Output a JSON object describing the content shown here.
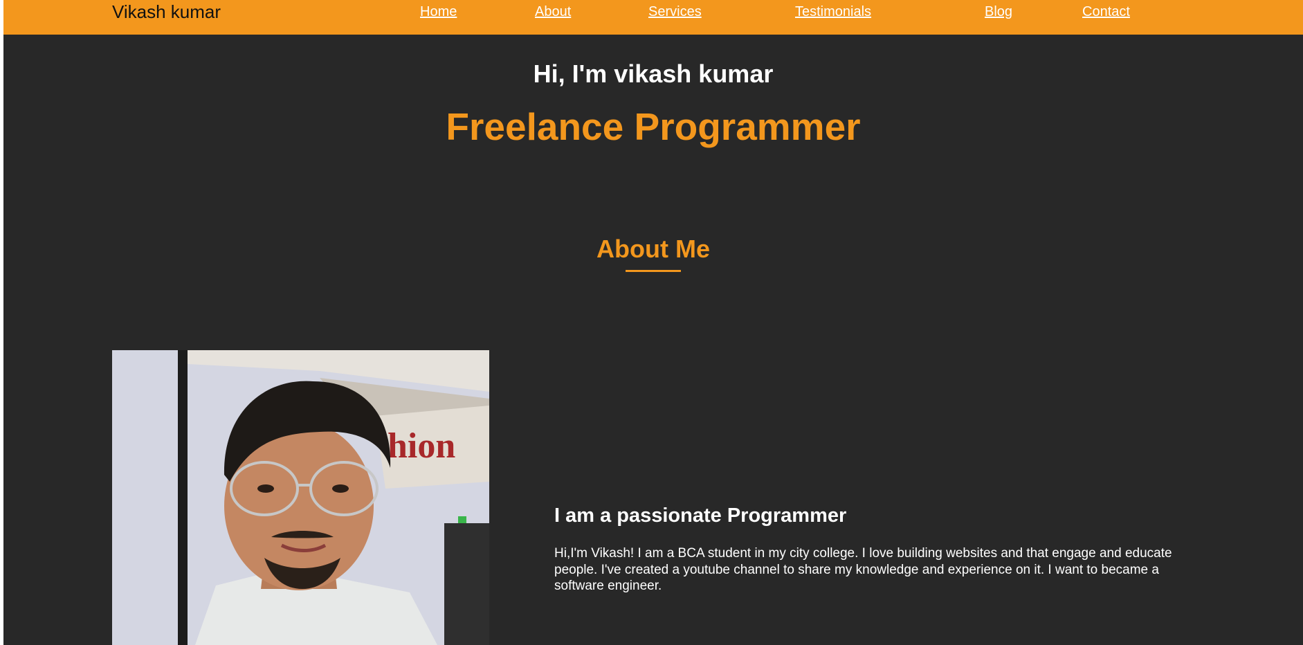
{
  "header": {
    "brand": "Vikash kumar",
    "nav": [
      {
        "label": "Home"
      },
      {
        "label": "About"
      },
      {
        "label": "Services"
      },
      {
        "label": "Testimonials"
      },
      {
        "label": "Blog"
      },
      {
        "label": "Contact"
      }
    ]
  },
  "hero": {
    "greeting": "Hi, I'm vikash kumar",
    "role": "Freelance Programmer"
  },
  "about": {
    "heading": "About Me",
    "subheading": "I am a passionate Programmer",
    "text": "Hi,I'm Vikash! I am a BCA student in my city college. I love building websites and that engage and educate people. I've created a youtube channel to share my knowledge and experience on it. I want to became a software engineer."
  },
  "colors": {
    "accent": "#f3971d",
    "background": "#282828",
    "text": "#ffffff",
    "brand_text": "#111111"
  }
}
